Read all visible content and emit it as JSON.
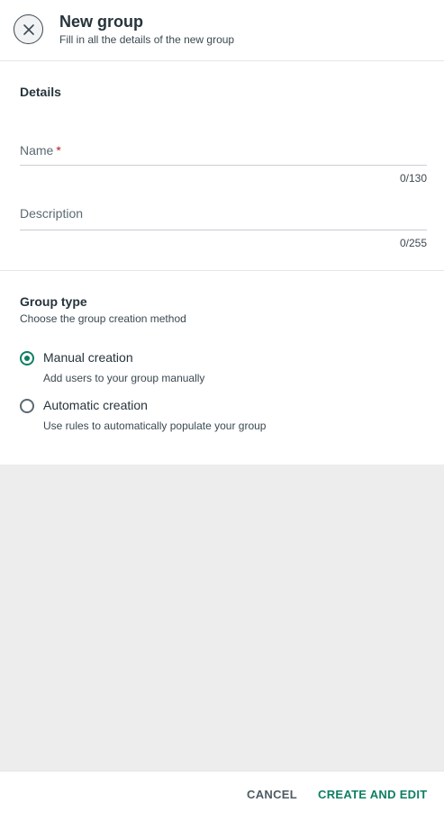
{
  "header": {
    "title": "New group",
    "subtitle": "Fill in all the details of the new group",
    "close_icon": "close-icon"
  },
  "details": {
    "section_title": "Details",
    "name": {
      "label": "Name",
      "required_mark": "*",
      "value": "",
      "counter": "0/130"
    },
    "description": {
      "label": "Description",
      "value": "",
      "counter": "0/255"
    }
  },
  "group_type": {
    "title": "Group type",
    "description": "Choose the group creation method",
    "options": [
      {
        "label": "Manual creation",
        "help": "Add users to your group manually",
        "selected": true
      },
      {
        "label": "Automatic creation",
        "help": "Use rules to automatically populate your group",
        "selected": false
      }
    ]
  },
  "footer": {
    "cancel_label": "CANCEL",
    "create_label": "CREATE AND EDIT"
  },
  "colors": {
    "accent": "#0e7f62",
    "required": "#b0232a",
    "empty_area": "#ededed"
  }
}
